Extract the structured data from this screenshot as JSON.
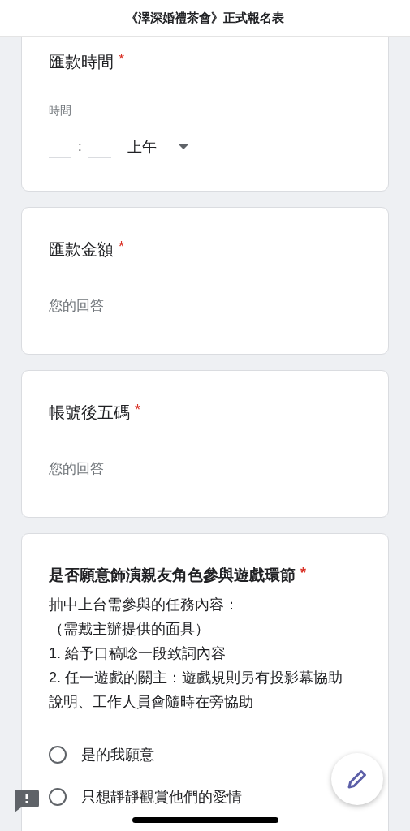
{
  "header": {
    "title": "《澤深婚禮茶會》正式報名表"
  },
  "questions": [
    {
      "kind": "time",
      "title": "匯款時間",
      "required_mark": "*",
      "time_label": "時間",
      "separator": ":",
      "period": "上午"
    },
    {
      "kind": "text",
      "title": "匯款金額",
      "required_mark": "*",
      "placeholder": "您的回答"
    },
    {
      "kind": "text",
      "title": "帳號後五碼",
      "required_mark": "*",
      "placeholder": "您的回答"
    },
    {
      "kind": "radio",
      "title": "是否願意飾演親友角色參與遊戲環節",
      "required_mark": "*",
      "description_lines": [
        "抽中上台需參與的任務內容：",
        "（需戴主辦提供的面具）",
        "1. 給予口稿唸一段致詞內容",
        "2. 任一遊戲的關主：遊戲規則另有投影幕協助說明、工作人員會隨時在旁協助"
      ],
      "options": [
        {
          "label": "是的我願意",
          "selected": false
        },
        {
          "label": "只想靜靜觀賞他們的愛情",
          "selected": false
        }
      ]
    }
  ]
}
